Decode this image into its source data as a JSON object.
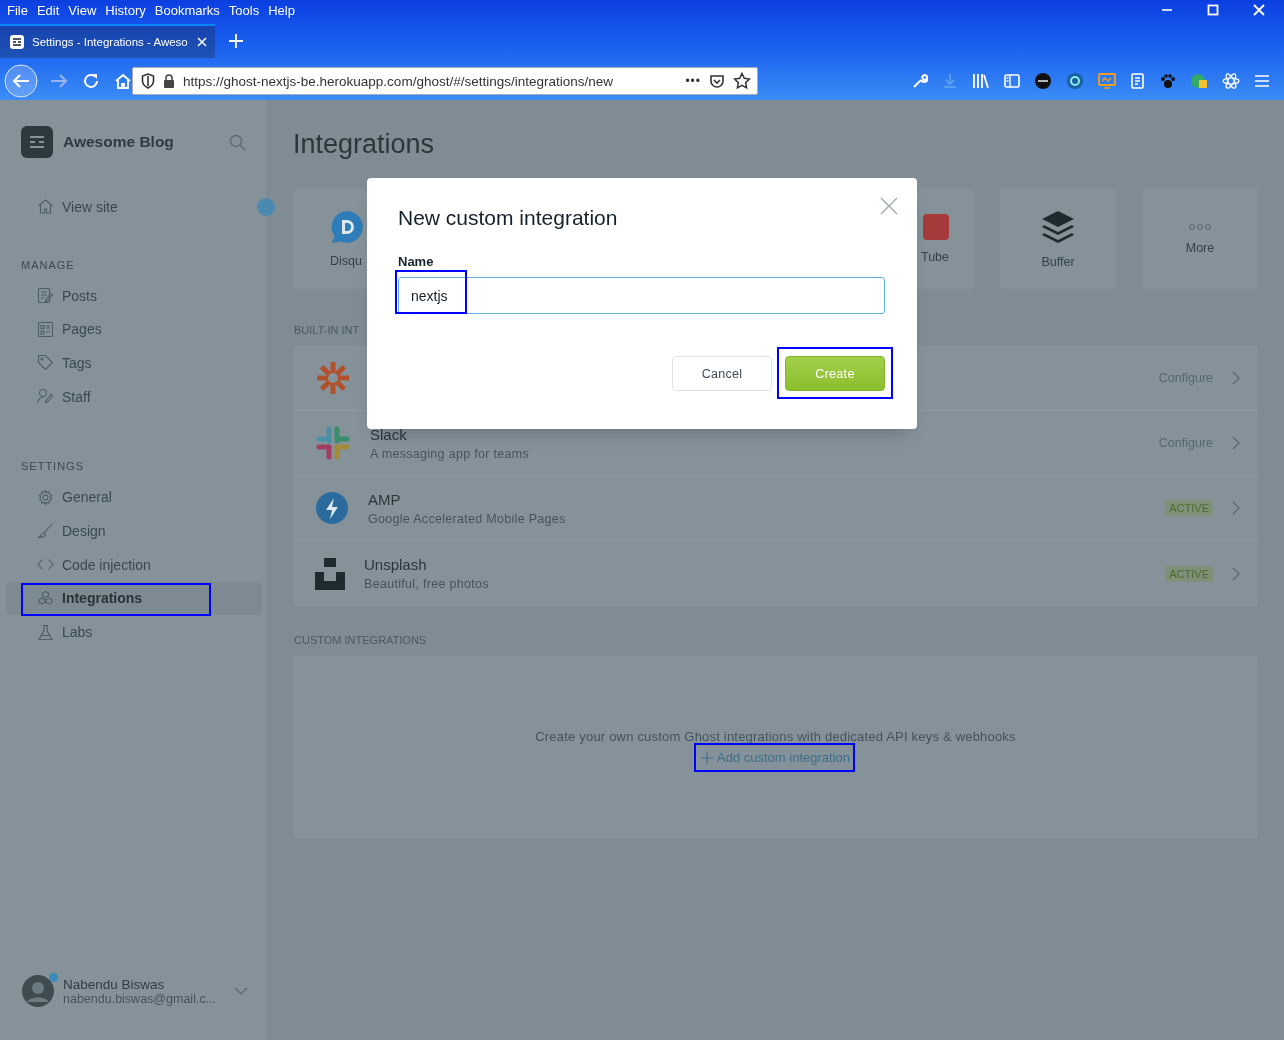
{
  "browser": {
    "menu": [
      "File",
      "Edit",
      "View",
      "History",
      "Bookmarks",
      "Tools",
      "Help"
    ],
    "tab": {
      "title": "Settings - Integrations - Aweso",
      "selected": true
    },
    "url": "https://ghost-nextjs-be.herokuapp.com/ghost/#/settings/integrations/new",
    "page_actions": "•••"
  },
  "sidebar": {
    "blog_name": "Awesome Blog",
    "view_site": "View site",
    "sections": [
      {
        "heading": "MANAGE",
        "items": [
          {
            "label": "Posts",
            "selected": false,
            "highlighted": false
          },
          {
            "label": "Pages",
            "selected": false,
            "highlighted": false
          },
          {
            "label": "Tags",
            "selected": false,
            "highlighted": false
          },
          {
            "label": "Staff",
            "selected": false,
            "highlighted": false
          }
        ]
      },
      {
        "heading": "SETTINGS",
        "items": [
          {
            "label": "General",
            "selected": false,
            "highlighted": false
          },
          {
            "label": "Design",
            "selected": false,
            "highlighted": false
          },
          {
            "label": "Code injection",
            "selected": false,
            "highlighted": false
          },
          {
            "label": "Integrations",
            "selected": true,
            "highlighted": true
          },
          {
            "label": "Labs",
            "selected": false,
            "highlighted": false
          }
        ]
      }
    ],
    "user": {
      "name": "Nabendu Biswas",
      "email": "nabendu.biswas@gmail.c..."
    }
  },
  "page": {
    "title": "Integrations",
    "featured_left": [
      {
        "label": "Disqu"
      }
    ],
    "featured_right": [
      {
        "label": "Tube"
      },
      {
        "label": "Buffer"
      },
      {
        "label": "More"
      }
    ],
    "built_in_heading": "BUILT-IN INT",
    "built_in": [
      {
        "kind": "configure",
        "status": "Configure"
      },
      {
        "title": "Slack",
        "description": "A messaging app for teams",
        "kind": "configure",
        "status": "Configure"
      },
      {
        "title": "AMP",
        "description": "Google Accelerated Mobile Pages",
        "kind": "active",
        "status": "ACTIVE"
      },
      {
        "title": "Unsplash",
        "description": "Beautiful, free photos",
        "kind": "active",
        "status": "ACTIVE"
      }
    ],
    "custom_heading": "CUSTOM INTEGRATIONS",
    "custom_text": "Create your own custom Ghost integrations with dedicated API keys & webhooks",
    "custom_link": {
      "label": "Add custom integration",
      "highlighted": true
    }
  },
  "modal": {
    "title": "New custom integration",
    "field_label": "Name",
    "value": "nextjs",
    "value_highlighted": true,
    "buttons": [
      {
        "label": "Cancel",
        "kind": "secondary",
        "highlighted": false
      },
      {
        "label": "Create",
        "kind": "primary",
        "highlighted": true
      }
    ]
  }
}
